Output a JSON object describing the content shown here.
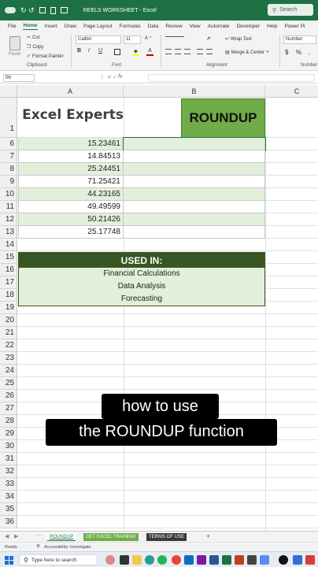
{
  "window": {
    "title": "REELS WORKSHEET - Excel",
    "search_placeholder": "Search",
    "autosave_label": "↻ ↺"
  },
  "menu": {
    "tabs": [
      "File",
      "Home",
      "Insert",
      "Draw",
      "Page Layout",
      "Formulas",
      "Data",
      "Review",
      "View",
      "Automate",
      "Developer",
      "Help",
      "Power Pi"
    ],
    "active": "Home"
  },
  "ribbon": {
    "paste_label": "Paste",
    "cut_label": "Cut",
    "copy_label": "Copy",
    "format_painter_label": "Format Painter",
    "clipboard_group": "Clipboard",
    "font_name": "Calibri",
    "font_size": "11",
    "font_group": "Font",
    "wrap_text_label": "Wrap Text",
    "merge_center_label": "Merge & Center",
    "alignment_group": "Alignment",
    "number_format": "Number",
    "number_group": "Number",
    "bold": "B",
    "italic": "I",
    "underline": "U",
    "currency": "$",
    "percent": "%"
  },
  "formula_bar": {
    "name_box": "B6",
    "fx_label": "fx",
    "content": ""
  },
  "sheet": {
    "col_headers": [
      "A",
      "B",
      "C"
    ],
    "logo_text": "Excel Experts",
    "header_b": "ROUNDUP",
    "row_numbers": [
      "1",
      "6",
      "7",
      "8",
      "9",
      "10",
      "11",
      "12",
      "13",
      "14",
      "15",
      "16",
      "17",
      "18",
      "19",
      "20",
      "21",
      "22",
      "23",
      "24",
      "25",
      "26",
      "27",
      "28",
      "29",
      "30",
      "31",
      "32",
      "33",
      "34",
      "35",
      "36"
    ],
    "values": [
      "15.23461",
      "14.84513",
      "25.24451",
      "71.25421",
      "44.23165",
      "49.49599",
      "50.21426",
      "25.17748"
    ],
    "used_in_title": "USED IN:",
    "used_in_items": [
      "Financial Calculations",
      "Data Analysis",
      "Forecasting"
    ]
  },
  "sheet_tabs": [
    "ROUNDUP",
    "GET EXCEL TRAINING",
    "TERMS OF USE"
  ],
  "add_sheet": "+",
  "status": {
    "ready": "Ready",
    "accessibility": "Accessibility: Investigate"
  },
  "taskbar": {
    "search_placeholder": "Type here to search"
  },
  "caption": {
    "line1": "how to use",
    "line2": "the ROUNDUP function"
  },
  "colors": {
    "excel_green": "#1e7145",
    "header_green": "#70ad47",
    "banded_green": "#e2efda",
    "used_in_dark": "#375623"
  }
}
